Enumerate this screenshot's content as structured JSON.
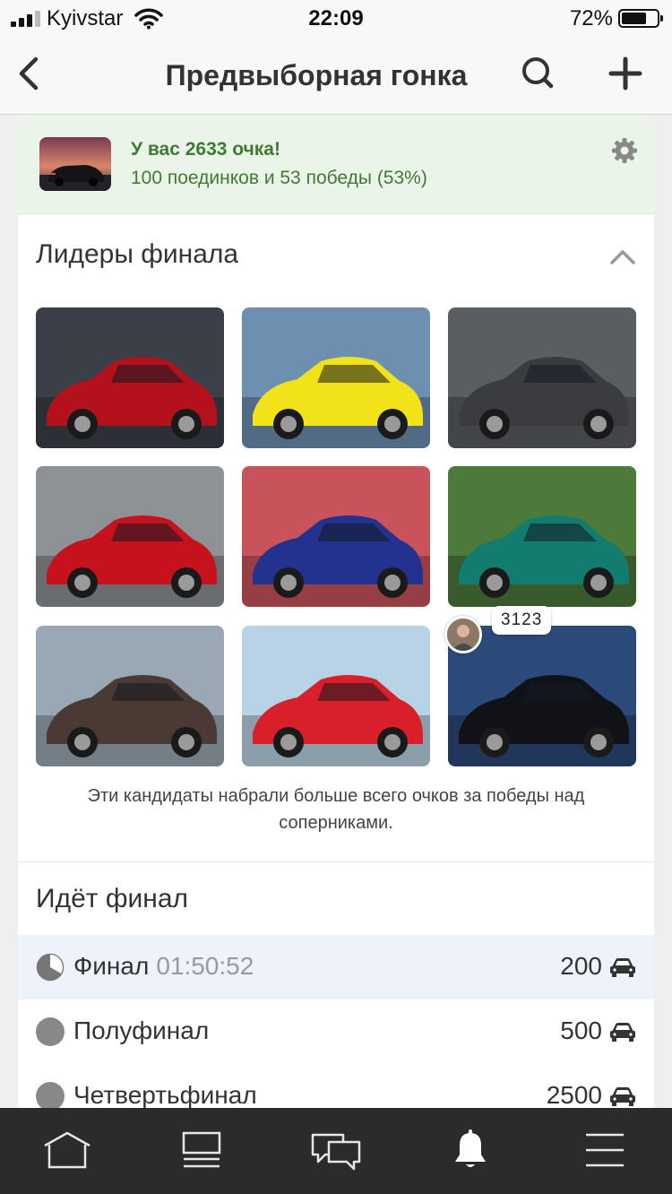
{
  "status_bar": {
    "carrier": "Kyivstar",
    "time": "22:09",
    "battery": "72%",
    "battery_level": 0.72
  },
  "header": {
    "title": "Предвыборная гонка",
    "back_icon": "chevron-left-icon",
    "search_icon": "search-icon",
    "add_icon": "plus-icon"
  },
  "score": {
    "title": "У вас 2633 очка!",
    "subtitle": "100 поединков и 53 победы (53%)",
    "settings_icon": "gear-icon"
  },
  "leaders": {
    "title": "Лидеры финала",
    "collapse_icon": "chevron-up-icon",
    "note": "Эти кандидаты набрали больше всего очков за победы над соперниками.",
    "bubble_score": "3123",
    "cars": [
      {
        "name": "red-bmw",
        "bg": "#3b3f47",
        "body": "#b3121c"
      },
      {
        "name": "yellow-skyline",
        "bg": "#6d8fb0",
        "body": "#f2e21a"
      },
      {
        "name": "grey-subaru",
        "bg": "#5a5d62",
        "body": "#3a3c40"
      },
      {
        "name": "red-lexus",
        "bg": "#8e9296",
        "body": "#c5121d"
      },
      {
        "name": "blue-supra",
        "bg": "#c9535a",
        "body": "#23318f"
      },
      {
        "name": "teal-beetle",
        "bg": "#4c7a3a",
        "body": "#127d6e"
      },
      {
        "name": "brown-audi",
        "bg": "#9aa8b5",
        "body": "#4a3a33"
      },
      {
        "name": "red-s2000",
        "bg": "#b9d3e6",
        "body": "#d91f2a"
      },
      {
        "name": "black-mustang",
        "bg": "#2b4a7a",
        "body": "#111217"
      }
    ]
  },
  "final": {
    "title": "Идёт финал",
    "stages": [
      {
        "label": "Финал",
        "timer": "01:50:52",
        "value": "200",
        "active": true,
        "status": "in-progress"
      },
      {
        "label": "Полуфинал",
        "timer": "",
        "value": "500",
        "active": false,
        "status": "done"
      },
      {
        "label": "Четвертьфинал",
        "timer": "",
        "value": "2500",
        "active": false,
        "status": "done"
      }
    ]
  },
  "nav": {
    "items": [
      "home-icon",
      "feed-icon",
      "messages-icon",
      "notifications-icon",
      "menu-icon"
    ],
    "active": "notifications-icon"
  },
  "colors": {
    "score_green": "#3f7a34",
    "score_bg": "#eaf4e8",
    "active_row": "#eef3fb",
    "nav_bg": "#2b2b2b"
  }
}
